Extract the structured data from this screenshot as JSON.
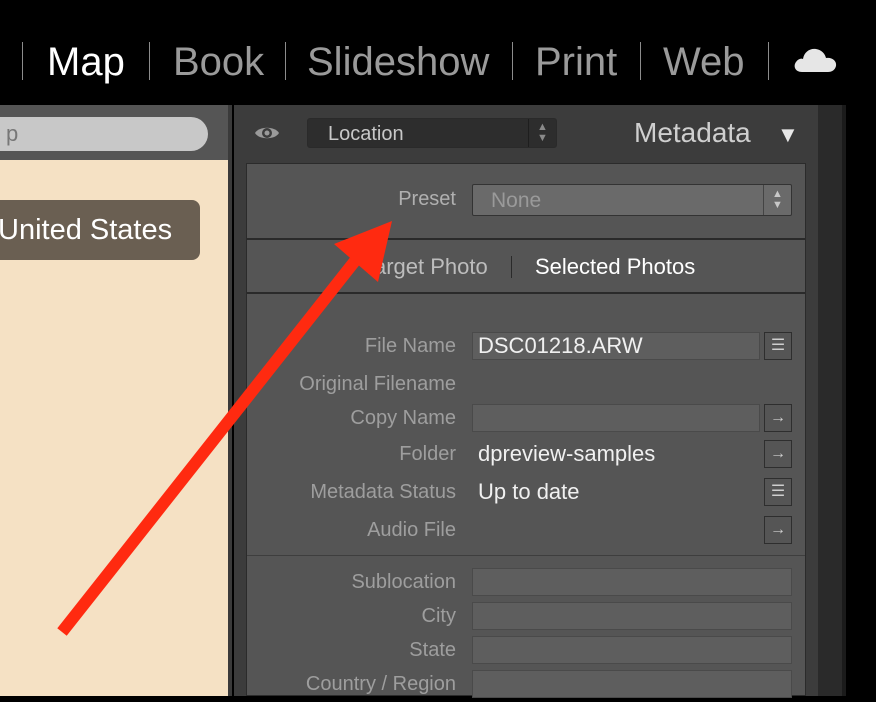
{
  "modules": [
    {
      "label": "Map",
      "active": true
    },
    {
      "label": "Book",
      "active": false
    },
    {
      "label": "Slideshow",
      "active": false
    },
    {
      "label": "Print",
      "active": false
    },
    {
      "label": "Web",
      "active": false
    }
  ],
  "map": {
    "search_glyph": "p",
    "location_label": "United States"
  },
  "panel": {
    "view_select": "Location",
    "title": "Metadata",
    "collapse_glyph": "▼",
    "preset_label": "Preset",
    "preset_value": "None",
    "tabs": {
      "target": "Target Photo",
      "selected": "Selected Photos"
    },
    "fields": {
      "file_name": {
        "label": "File Name",
        "value": "DSC01218.ARW"
      },
      "original_filename": {
        "label": "Original Filename",
        "value": ""
      },
      "copy_name": {
        "label": "Copy Name",
        "value": ""
      },
      "folder": {
        "label": "Folder",
        "value": "dpreview-samples"
      },
      "metadata_status": {
        "label": "Metadata Status",
        "value": "Up to date"
      },
      "audio_file": {
        "label": "Audio File",
        "value": ""
      },
      "sublocation": {
        "label": "Sublocation",
        "value": ""
      },
      "city": {
        "label": "City",
        "value": ""
      },
      "state": {
        "label": "State",
        "value": ""
      },
      "country_region": {
        "label": "Country / Region",
        "value": ""
      }
    }
  },
  "icons": {
    "cloud": "cloud-icon",
    "eye": "eye-icon",
    "list": "list-icon",
    "arrow_right": "arrow-right-icon",
    "annotation_arrow": "red-arrow-annotation"
  },
  "colors": {
    "annotation_red": "#ff2a10",
    "map_background": "#f5e1c4",
    "panel_bg": "#555555"
  }
}
